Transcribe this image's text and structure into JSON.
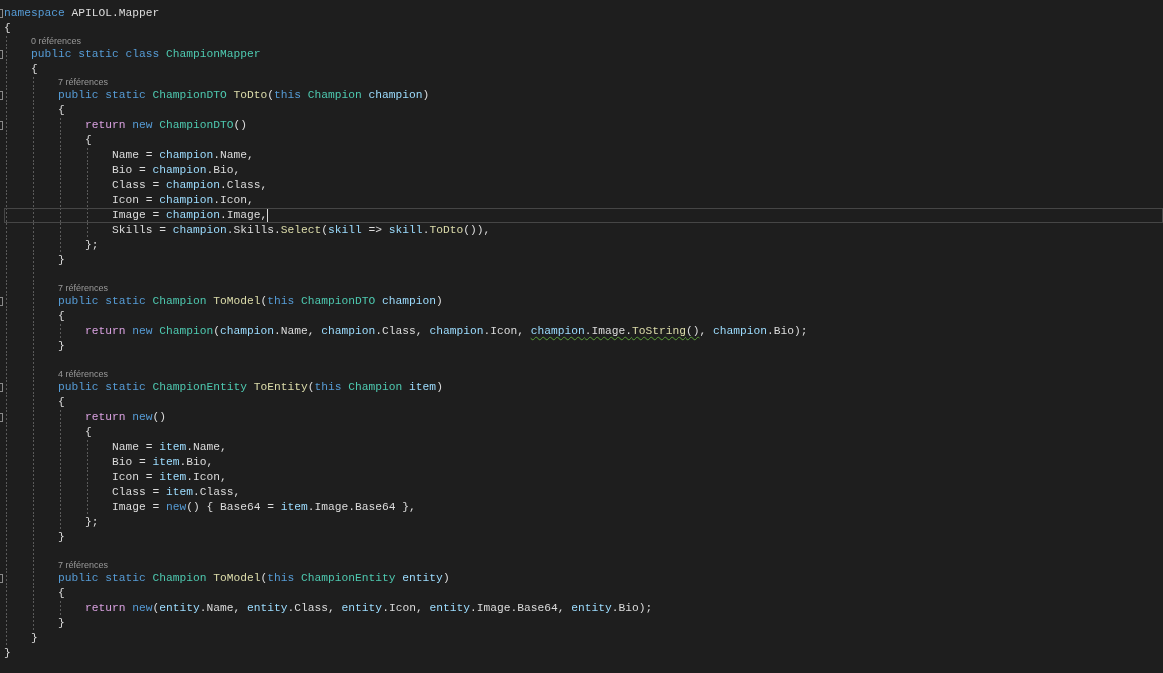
{
  "editor": {
    "lines": [
      {
        "kind": "code",
        "fold": true,
        "tokens": [
          {
            "kind": "keyword",
            "text": "namespace"
          },
          {
            "kind": "plain",
            "text": " APILOL.Mapper"
          }
        ]
      },
      {
        "kind": "code",
        "tokens": [
          {
            "kind": "plain",
            "text": "{"
          }
        ],
        "children": [
          {
            "kind": "codelens",
            "text": "0 références"
          },
          {
            "kind": "code",
            "fold": true,
            "tokens": [
              {
                "kind": "keyword",
                "text": "public static class "
              },
              {
                "kind": "type",
                "text": "ChampionMapper"
              }
            ]
          },
          {
            "kind": "code",
            "tokens": [
              {
                "kind": "plain",
                "text": "{"
              }
            ],
            "children": [
              {
                "kind": "codelens",
                "text": "7 références"
              },
              {
                "kind": "code",
                "fold": true,
                "tokens": [
                  {
                    "kind": "keyword",
                    "text": "public static "
                  },
                  {
                    "kind": "type",
                    "text": "ChampionDTO "
                  },
                  {
                    "kind": "method",
                    "text": "ToDto"
                  },
                  {
                    "kind": "plain",
                    "text": "("
                  },
                  {
                    "kind": "keyword",
                    "text": "this "
                  },
                  {
                    "kind": "type",
                    "text": "Champion "
                  },
                  {
                    "kind": "variable",
                    "text": "champion"
                  },
                  {
                    "kind": "plain",
                    "text": ")"
                  }
                ]
              },
              {
                "kind": "code",
                "tokens": [
                  {
                    "kind": "plain",
                    "text": "{"
                  }
                ],
                "children": [
                  {
                    "kind": "code",
                    "fold": true,
                    "tokens": [
                      {
                        "kind": "control",
                        "text": "return "
                      },
                      {
                        "kind": "keyword",
                        "text": "new "
                      },
                      {
                        "kind": "type",
                        "text": "ChampionDTO"
                      },
                      {
                        "kind": "plain",
                        "text": "()"
                      }
                    ]
                  },
                  {
                    "kind": "code",
                    "tokens": [
                      {
                        "kind": "plain",
                        "text": "{"
                      }
                    ],
                    "children": [
                      {
                        "kind": "code",
                        "tokens": [
                          {
                            "kind": "plain",
                            "text": "Name = "
                          },
                          {
                            "kind": "variable",
                            "text": "champion"
                          },
                          {
                            "kind": "plain",
                            "text": ".Name,"
                          }
                        ]
                      },
                      {
                        "kind": "code",
                        "tokens": [
                          {
                            "kind": "plain",
                            "text": "Bio = "
                          },
                          {
                            "kind": "variable",
                            "text": "champion"
                          },
                          {
                            "kind": "plain",
                            "text": ".Bio,"
                          }
                        ]
                      },
                      {
                        "kind": "code",
                        "tokens": [
                          {
                            "kind": "plain",
                            "text": "Class = "
                          },
                          {
                            "kind": "variable",
                            "text": "champion"
                          },
                          {
                            "kind": "plain",
                            "text": ".Class,"
                          }
                        ]
                      },
                      {
                        "kind": "code",
                        "tokens": [
                          {
                            "kind": "plain",
                            "text": "Icon = "
                          },
                          {
                            "kind": "variable",
                            "text": "champion"
                          },
                          {
                            "kind": "plain",
                            "text": ".Icon,"
                          }
                        ]
                      },
                      {
                        "kind": "code",
                        "current": true,
                        "tokens": [
                          {
                            "kind": "plain",
                            "text": "Image = "
                          },
                          {
                            "kind": "variable",
                            "text": "champion"
                          },
                          {
                            "kind": "plain",
                            "text": ".Image,"
                          }
                        ]
                      },
                      {
                        "kind": "code",
                        "tokens": [
                          {
                            "kind": "plain",
                            "text": "Skills = "
                          },
                          {
                            "kind": "variable",
                            "text": "champion"
                          },
                          {
                            "kind": "plain",
                            "text": ".Skills."
                          },
                          {
                            "kind": "method",
                            "text": "Select"
                          },
                          {
                            "kind": "plain",
                            "text": "("
                          },
                          {
                            "kind": "variable",
                            "text": "skill"
                          },
                          {
                            "kind": "plain",
                            "text": " => "
                          },
                          {
                            "kind": "variable",
                            "text": "skill"
                          },
                          {
                            "kind": "plain",
                            "text": "."
                          },
                          {
                            "kind": "method",
                            "text": "ToDto"
                          },
                          {
                            "kind": "plain",
                            "text": "()),"
                          }
                        ]
                      }
                    ]
                  },
                  {
                    "kind": "code",
                    "tokens": [
                      {
                        "kind": "plain",
                        "text": "};"
                      }
                    ]
                  }
                ]
              },
              {
                "kind": "code",
                "tokens": [
                  {
                    "kind": "plain",
                    "text": "}"
                  }
                ]
              },
              {
                "kind": "blank"
              },
              {
                "kind": "codelens",
                "text": "7 références"
              },
              {
                "kind": "code",
                "fold": true,
                "tokens": [
                  {
                    "kind": "keyword",
                    "text": "public static "
                  },
                  {
                    "kind": "type",
                    "text": "Champion "
                  },
                  {
                    "kind": "method",
                    "text": "ToModel"
                  },
                  {
                    "kind": "plain",
                    "text": "("
                  },
                  {
                    "kind": "keyword",
                    "text": "this "
                  },
                  {
                    "kind": "type",
                    "text": "ChampionDTO "
                  },
                  {
                    "kind": "variable",
                    "text": "champion"
                  },
                  {
                    "kind": "plain",
                    "text": ")"
                  }
                ]
              },
              {
                "kind": "code",
                "tokens": [
                  {
                    "kind": "plain",
                    "text": "{"
                  }
                ],
                "children": [
                  {
                    "kind": "code",
                    "tokens": [
                      {
                        "kind": "control",
                        "text": "return "
                      },
                      {
                        "kind": "keyword",
                        "text": "new "
                      },
                      {
                        "kind": "type",
                        "text": "Champion"
                      },
                      {
                        "kind": "plain",
                        "text": "("
                      },
                      {
                        "kind": "variable",
                        "text": "champion"
                      },
                      {
                        "kind": "plain",
                        "text": ".Name, "
                      },
                      {
                        "kind": "variable",
                        "text": "champion"
                      },
                      {
                        "kind": "plain",
                        "text": ".Class, "
                      },
                      {
                        "kind": "variable",
                        "text": "champion"
                      },
                      {
                        "kind": "plain",
                        "text": ".Icon, "
                      },
                      {
                        "kind": "variable",
                        "text": "champion",
                        "squiggle": true
                      },
                      {
                        "kind": "plain",
                        "text": ".Image.",
                        "squiggle": true
                      },
                      {
                        "kind": "method",
                        "text": "ToString",
                        "squiggle": true
                      },
                      {
                        "kind": "plain",
                        "text": "()",
                        "squiggle": true
                      },
                      {
                        "kind": "plain",
                        "text": ", "
                      },
                      {
                        "kind": "variable",
                        "text": "champion"
                      },
                      {
                        "kind": "plain",
                        "text": ".Bio);"
                      }
                    ]
                  }
                ]
              },
              {
                "kind": "code",
                "tokens": [
                  {
                    "kind": "plain",
                    "text": "}"
                  }
                ]
              },
              {
                "kind": "blank"
              },
              {
                "kind": "codelens",
                "text": "4 références"
              },
              {
                "kind": "code",
                "fold": true,
                "tokens": [
                  {
                    "kind": "keyword",
                    "text": "public static "
                  },
                  {
                    "kind": "type",
                    "text": "ChampionEntity "
                  },
                  {
                    "kind": "method",
                    "text": "ToEntity"
                  },
                  {
                    "kind": "plain",
                    "text": "("
                  },
                  {
                    "kind": "keyword",
                    "text": "this "
                  },
                  {
                    "kind": "type",
                    "text": "Champion "
                  },
                  {
                    "kind": "variable",
                    "text": "item"
                  },
                  {
                    "kind": "plain",
                    "text": ")"
                  }
                ]
              },
              {
                "kind": "code",
                "tokens": [
                  {
                    "kind": "plain",
                    "text": "{"
                  }
                ],
                "children": [
                  {
                    "kind": "code",
                    "fold": true,
                    "tokens": [
                      {
                        "kind": "control",
                        "text": "return "
                      },
                      {
                        "kind": "keyword",
                        "text": "new"
                      },
                      {
                        "kind": "plain",
                        "text": "()"
                      }
                    ]
                  },
                  {
                    "kind": "code",
                    "tokens": [
                      {
                        "kind": "plain",
                        "text": "{"
                      }
                    ],
                    "children": [
                      {
                        "kind": "code",
                        "tokens": [
                          {
                            "kind": "plain",
                            "text": "Name = "
                          },
                          {
                            "kind": "variable",
                            "text": "item"
                          },
                          {
                            "kind": "plain",
                            "text": ".Name,"
                          }
                        ]
                      },
                      {
                        "kind": "code",
                        "tokens": [
                          {
                            "kind": "plain",
                            "text": "Bio = "
                          },
                          {
                            "kind": "variable",
                            "text": "item"
                          },
                          {
                            "kind": "plain",
                            "text": ".Bio,"
                          }
                        ]
                      },
                      {
                        "kind": "code",
                        "tokens": [
                          {
                            "kind": "plain",
                            "text": "Icon = "
                          },
                          {
                            "kind": "variable",
                            "text": "item"
                          },
                          {
                            "kind": "plain",
                            "text": ".Icon,"
                          }
                        ]
                      },
                      {
                        "kind": "code",
                        "tokens": [
                          {
                            "kind": "plain",
                            "text": "Class = "
                          },
                          {
                            "kind": "variable",
                            "text": "item"
                          },
                          {
                            "kind": "plain",
                            "text": ".Class,"
                          }
                        ]
                      },
                      {
                        "kind": "code",
                        "tokens": [
                          {
                            "kind": "plain",
                            "text": "Image = "
                          },
                          {
                            "kind": "keyword",
                            "text": "new"
                          },
                          {
                            "kind": "plain",
                            "text": "() { Base64 = "
                          },
                          {
                            "kind": "variable",
                            "text": "item"
                          },
                          {
                            "kind": "plain",
                            "text": ".Image.Base64 },"
                          }
                        ]
                      }
                    ]
                  },
                  {
                    "kind": "code",
                    "tokens": [
                      {
                        "kind": "plain",
                        "text": "};"
                      }
                    ]
                  }
                ]
              },
              {
                "kind": "code",
                "tokens": [
                  {
                    "kind": "plain",
                    "text": "}"
                  }
                ]
              },
              {
                "kind": "blank"
              },
              {
                "kind": "codelens",
                "text": "7 références"
              },
              {
                "kind": "code",
                "fold": true,
                "tokens": [
                  {
                    "kind": "keyword",
                    "text": "public static "
                  },
                  {
                    "kind": "type",
                    "text": "Champion "
                  },
                  {
                    "kind": "method",
                    "text": "ToModel"
                  },
                  {
                    "kind": "plain",
                    "text": "("
                  },
                  {
                    "kind": "keyword",
                    "text": "this "
                  },
                  {
                    "kind": "type",
                    "text": "ChampionEntity "
                  },
                  {
                    "kind": "variable",
                    "text": "entity"
                  },
                  {
                    "kind": "plain",
                    "text": ")"
                  }
                ]
              },
              {
                "kind": "code",
                "tokens": [
                  {
                    "kind": "plain",
                    "text": "{"
                  }
                ],
                "children": [
                  {
                    "kind": "code",
                    "tokens": [
                      {
                        "kind": "control",
                        "text": "return "
                      },
                      {
                        "kind": "keyword",
                        "text": "new"
                      },
                      {
                        "kind": "plain",
                        "text": "("
                      },
                      {
                        "kind": "variable",
                        "text": "entity"
                      },
                      {
                        "kind": "plain",
                        "text": ".Name, "
                      },
                      {
                        "kind": "variable",
                        "text": "entity"
                      },
                      {
                        "kind": "plain",
                        "text": ".Class, "
                      },
                      {
                        "kind": "variable",
                        "text": "entity"
                      },
                      {
                        "kind": "plain",
                        "text": ".Icon, "
                      },
                      {
                        "kind": "variable",
                        "text": "entity"
                      },
                      {
                        "kind": "plain",
                        "text": ".Image.Base64, "
                      },
                      {
                        "kind": "variable",
                        "text": "entity"
                      },
                      {
                        "kind": "plain",
                        "text": ".Bio);"
                      }
                    ]
                  }
                ]
              },
              {
                "kind": "code",
                "tokens": [
                  {
                    "kind": "plain",
                    "text": "}"
                  }
                ]
              }
            ]
          },
          {
            "kind": "code",
            "tokens": [
              {
                "kind": "plain",
                "text": "}"
              }
            ]
          }
        ]
      },
      {
        "kind": "code",
        "tokens": [
          {
            "kind": "plain",
            "text": "}"
          }
        ]
      }
    ]
  }
}
